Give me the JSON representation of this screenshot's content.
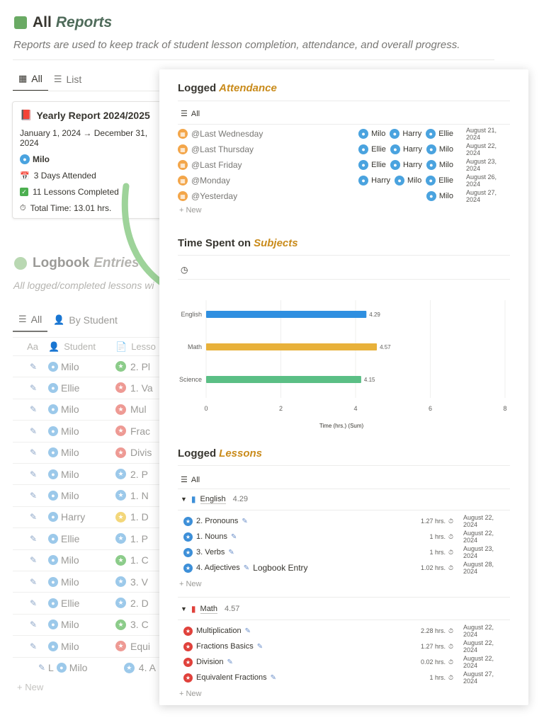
{
  "reports": {
    "title_main": "All",
    "title_accent": "Reports",
    "description": "Reports are used to keep track of student lesson completion, attendance, and overall progress.",
    "tabs": [
      {
        "label": "All"
      },
      {
        "label": "List"
      }
    ],
    "card": {
      "title": "Yearly Report 2024/2025",
      "date_range": "January 1, 2024 → December 31, 2024",
      "student": "Milo",
      "days": "3 Days Attended",
      "lessons": "11 Lessons Completed",
      "total_time": "Total Time: 13.01 hrs."
    }
  },
  "logbook": {
    "title_main": "Logbook",
    "title_accent": "Entries",
    "description": "All logged/completed lessons wi",
    "tabs": [
      {
        "label": "All"
      },
      {
        "label": "By Student"
      }
    ],
    "headers": {
      "aa": "Aa",
      "student": "Student",
      "lesson": "Lesso"
    },
    "rows": [
      {
        "student": "Milo",
        "lesson": "2. Pl",
        "color": "green"
      },
      {
        "student": "Ellie",
        "lesson": "1. Va",
        "color": "red"
      },
      {
        "student": "Milo",
        "lesson": "Mul",
        "color": "red"
      },
      {
        "student": "Milo",
        "lesson": "Frac",
        "color": "red"
      },
      {
        "student": "Milo",
        "lesson": "Divis",
        "color": "red"
      },
      {
        "student": "Milo",
        "lesson": "2. P",
        "color": "blue"
      },
      {
        "student": "Milo",
        "lesson": "1. N",
        "color": "blue"
      },
      {
        "student": "Harry",
        "lesson": "1. D",
        "color": "yellow"
      },
      {
        "student": "Ellie",
        "lesson": "1. P",
        "color": "blue"
      },
      {
        "student": "Milo",
        "lesson": "1. C",
        "color": "green"
      },
      {
        "student": "Milo",
        "lesson": "3. V",
        "color": "blue"
      },
      {
        "student": "Ellie",
        "lesson": "2. D",
        "color": "blue"
      },
      {
        "student": "Milo",
        "lesson": "3. C",
        "color": "green"
      },
      {
        "student": "Milo",
        "lesson": "Equi",
        "color": "red"
      },
      {
        "student": "Milo",
        "lesson": "4. A",
        "color": "blue",
        "extra": "L"
      }
    ],
    "new_label": "New"
  },
  "attendance": {
    "title_main": "Logged",
    "title_accent": "Attendance",
    "view": "All",
    "rows": [
      {
        "day": "@Last Wednesday",
        "students": [
          "Milo",
          "Harry",
          "Ellie"
        ],
        "date": "August 21, 2024"
      },
      {
        "day": "@Last Thursday",
        "students": [
          "Ellie",
          "Harry",
          "Milo"
        ],
        "date": "August 22, 2024"
      },
      {
        "day": "@Last Friday",
        "students": [
          "Ellie",
          "Harry",
          "Milo"
        ],
        "date": "August 23, 2024"
      },
      {
        "day": "@Monday",
        "students": [
          "Harry",
          "Milo",
          "Ellie"
        ],
        "date": "August 26, 2024"
      },
      {
        "day": "@Yesterday",
        "students": [
          "Milo"
        ],
        "date": "August 27, 2024"
      }
    ],
    "new_label": "New"
  },
  "time_spent": {
    "title_main": "Time Spent on",
    "title_accent": "Subjects"
  },
  "chart_data": {
    "type": "bar",
    "orientation": "horizontal",
    "categories": [
      "English",
      "Math",
      "Science"
    ],
    "values": [
      4.29,
      4.57,
      4.15
    ],
    "value_labels": [
      "4.29",
      "4.57",
      "4.15"
    ],
    "colors": [
      "#2f8fe0",
      "#e8b13a",
      "#5bbf85"
    ],
    "xlabel": "Time (hrs.) (Sum)",
    "xlim": [
      0,
      8
    ],
    "xticks": [
      "0",
      "2",
      "4",
      "6",
      "8"
    ],
    "grid": true
  },
  "lessons": {
    "title_main": "Logged",
    "title_accent": "Lessons",
    "view": "All",
    "groups": [
      {
        "name": "English",
        "sum": "4.29",
        "color": "blue",
        "rows": [
          {
            "title": "2. Pronouns",
            "extra": "",
            "hrs": "1.27 hrs.",
            "date": "August 22, 2024"
          },
          {
            "title": "1. Nouns",
            "extra": "",
            "hrs": "1 hrs.",
            "date": "August 22, 2024"
          },
          {
            "title": "3. Verbs",
            "extra": "",
            "hrs": "1 hrs.",
            "date": "August 23, 2024"
          },
          {
            "title": "4. Adjectives",
            "extra": "Logbook Entry",
            "hrs": "1.02 hrs.",
            "date": "August 28, 2024"
          }
        ],
        "new_label": "New"
      },
      {
        "name": "Math",
        "sum": "4.57",
        "color": "red",
        "rows": [
          {
            "title": "Multiplication",
            "extra": "",
            "hrs": "2.28 hrs.",
            "date": "August 22, 2024"
          },
          {
            "title": "Fractions Basics",
            "extra": "",
            "hrs": "1.27 hrs.",
            "date": "August 22, 2024"
          },
          {
            "title": "Division",
            "extra": "",
            "hrs": "0.02 hrs.",
            "date": "August 22, 2024"
          },
          {
            "title": "Equivalent Fractions",
            "extra": "",
            "hrs": "1 hrs.",
            "date": "August 27, 2024"
          }
        ],
        "new_label": "New"
      }
    ]
  }
}
